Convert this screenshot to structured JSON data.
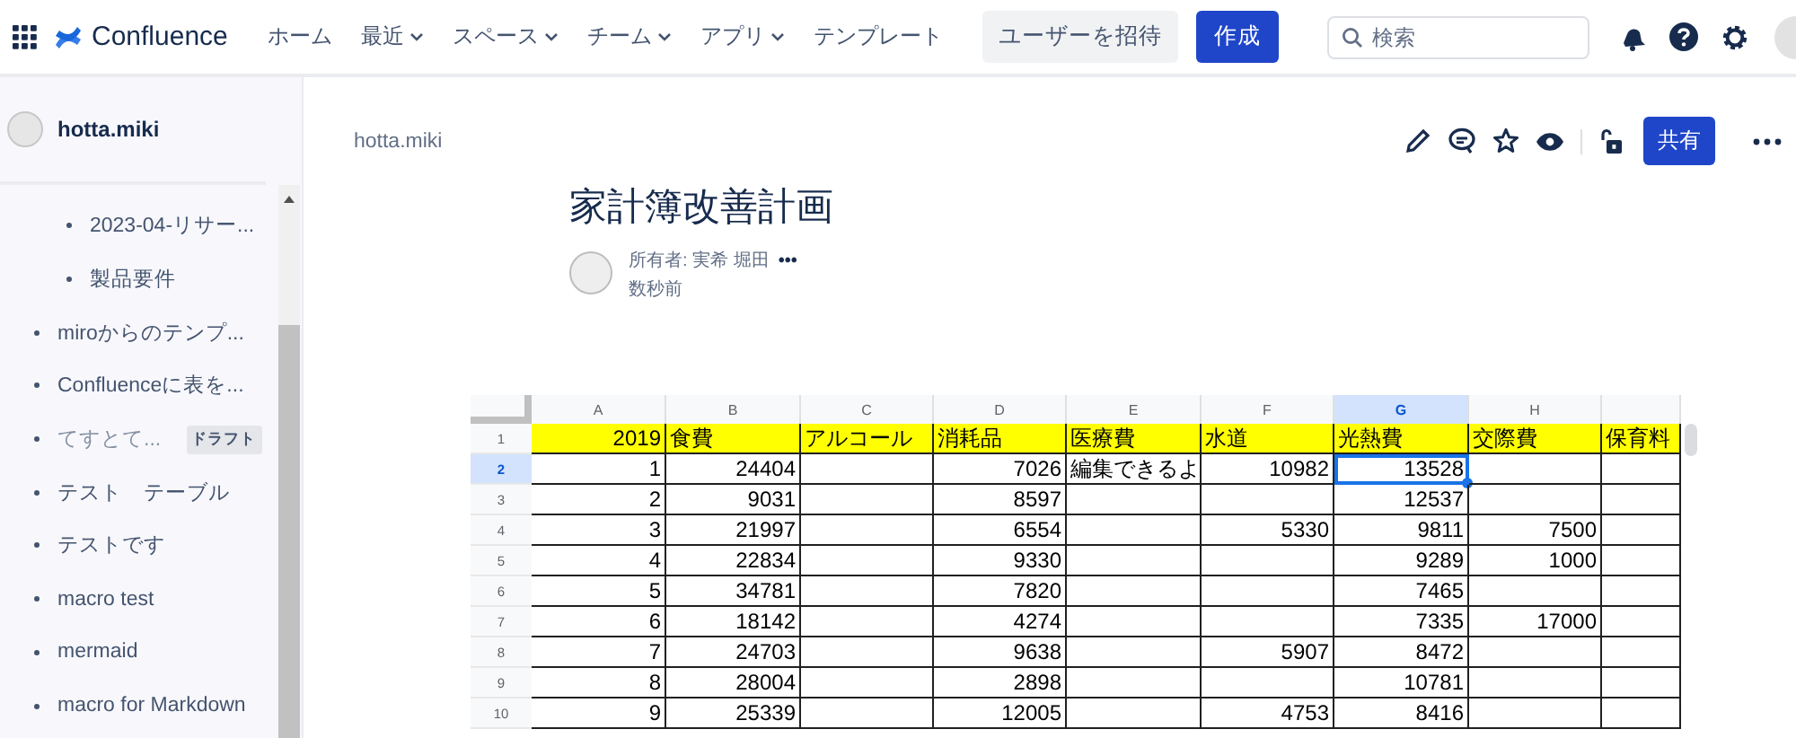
{
  "top_bar": {
    "product": "Confluence",
    "nav": [
      {
        "label": "ホーム",
        "dropdown": false
      },
      {
        "label": "最近",
        "dropdown": true
      },
      {
        "label": "スペース",
        "dropdown": true
      },
      {
        "label": "チーム",
        "dropdown": true
      },
      {
        "label": "アプリ",
        "dropdown": true
      },
      {
        "label": "テンプレート",
        "dropdown": false
      }
    ],
    "invite_button": "ユーザーを招待",
    "create_button": "作成",
    "search": {
      "placeholder": "検索"
    }
  },
  "sidebar": {
    "space_name": "hotta.miki",
    "items": [
      {
        "children": [
          {
            "label": "2023-04-リサー...",
            "draft": false
          },
          {
            "label": "製品要件",
            "draft": false
          }
        ]
      },
      {
        "label": "miroからのテンプ...",
        "draft": false
      },
      {
        "label": "Confluenceに表を...",
        "draft": false
      },
      {
        "label": "てすとて...",
        "draft": true,
        "badge": "ドラフト"
      },
      {
        "label": "テスト　テーブル",
        "draft": false
      },
      {
        "label": "テストです",
        "draft": false
      },
      {
        "label": "macro test",
        "draft": false
      },
      {
        "label": "mermaid",
        "draft": false
      },
      {
        "label": "macro for Markdown",
        "draft": false
      }
    ]
  },
  "page": {
    "breadcrumb": "hotta.miki",
    "share_button": "共有",
    "title": "家計簿改善計画",
    "owner": "所有者: 実希 堀田",
    "more": "•••",
    "updated": "数秒前"
  },
  "sheet": {
    "columns": [
      {
        "label": "A",
        "selected": false
      },
      {
        "label": "B",
        "selected": false
      },
      {
        "label": "C",
        "selected": false
      },
      {
        "label": "D",
        "selected": false
      },
      {
        "label": "E",
        "selected": false
      },
      {
        "label": "F",
        "selected": false
      },
      {
        "label": "G",
        "selected": true
      },
      {
        "label": "H",
        "selected": false
      },
      {
        "selected": false
      }
    ],
    "rows": [
      {
        "number": "1",
        "selected": false,
        "header": true,
        "cells": [
          "2019",
          "食費",
          "アルコール",
          "消耗品",
          "医療費",
          "水道",
          "光熱費",
          "交際費",
          "保育料"
        ]
      },
      {
        "number": "2",
        "selected": true,
        "header": false,
        "cells": [
          "1",
          "24404",
          null,
          "7026",
          "編集できるよ",
          "10982",
          "13528",
          null,
          null
        ]
      },
      {
        "number": "3",
        "selected": false,
        "header": false,
        "cells": [
          "2",
          "9031",
          null,
          "8597",
          null,
          null,
          "12537",
          null,
          null
        ]
      },
      {
        "number": "4",
        "selected": false,
        "header": false,
        "cells": [
          "3",
          "21997",
          null,
          "6554",
          null,
          "5330",
          "9811",
          "7500",
          null
        ]
      },
      {
        "number": "5",
        "selected": false,
        "header": false,
        "cells": [
          "4",
          "22834",
          null,
          "9330",
          null,
          null,
          "9289",
          "1000",
          null
        ]
      },
      {
        "number": "6",
        "selected": false,
        "header": false,
        "cells": [
          "5",
          "34781",
          null,
          "7820",
          null,
          null,
          "7465",
          null,
          null
        ]
      },
      {
        "number": "7",
        "selected": false,
        "header": false,
        "cells": [
          "6",
          "18142",
          null,
          "4274",
          null,
          null,
          "7335",
          "17000",
          null
        ]
      },
      {
        "number": "8",
        "selected": false,
        "header": false,
        "cells": [
          "7",
          "24703",
          null,
          "9638",
          null,
          "5907",
          "8472",
          null,
          null
        ]
      },
      {
        "number": "9",
        "selected": false,
        "header": false,
        "cells": [
          "8",
          "28004",
          null,
          "2898",
          null,
          null,
          "10781",
          null,
          null
        ]
      },
      {
        "number": "10",
        "selected": false,
        "header": false,
        "cells": [
          "9",
          "25339",
          null,
          "12005",
          null,
          "4753",
          "8416",
          null,
          null
        ]
      }
    ]
  }
}
